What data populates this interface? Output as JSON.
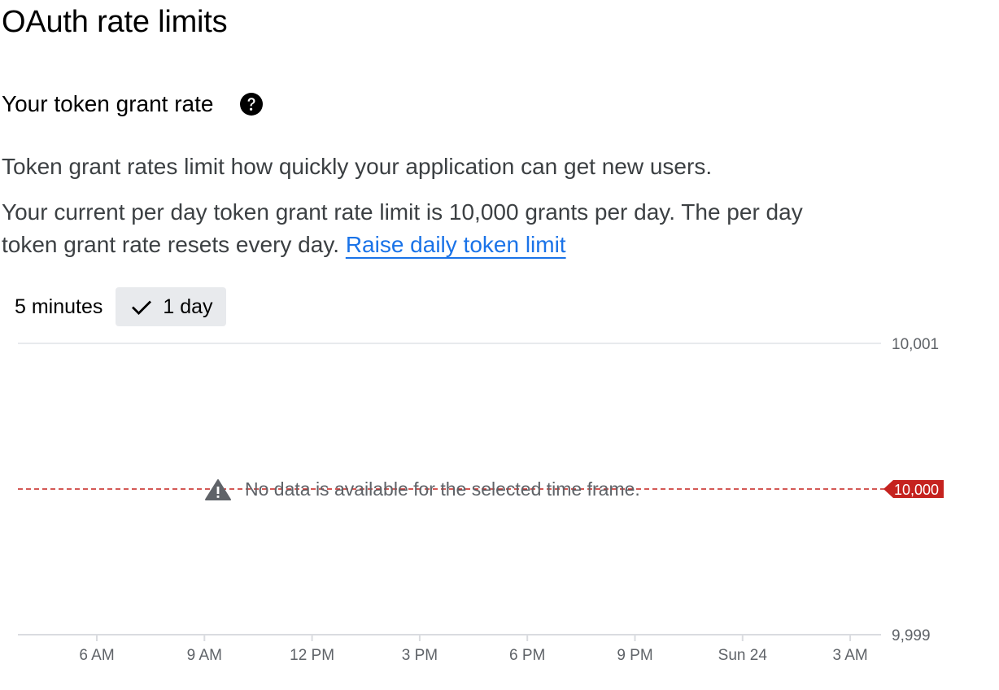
{
  "page": {
    "title": "OAuth rate limits"
  },
  "section": {
    "title": "Your token grant rate",
    "help_icon": "help-circle-icon",
    "description_1": "Token grant rates limit how quickly your application can get new users.",
    "description_2": "Your current per day token grant rate limit is 10,000 grants per day. The per day token grant rate resets every day.",
    "link_label": "Raise daily token limit"
  },
  "tabs": [
    {
      "label": "5 minutes",
      "selected": false
    },
    {
      "label": "1 day",
      "selected": true,
      "icon": "check-icon"
    }
  ],
  "colors": {
    "link": "#1a73e8",
    "limit": "#c5221f",
    "axis": "#dadce0",
    "muted_text": "#5f6368"
  },
  "chart_data": {
    "type": "line",
    "x_ticks": [
      "6 AM",
      "9 AM",
      "12 PM",
      "3 PM",
      "6 PM",
      "9 PM",
      "Sun 24",
      "3 AM"
    ],
    "y_ticks": [
      "10,001",
      "9,999"
    ],
    "ylim": [
      9999,
      10001
    ],
    "series": [],
    "limit": {
      "value": 10000,
      "label": "10,000"
    },
    "empty_message": "No data is available for the selected time frame.",
    "empty_icon": "warning-icon",
    "grid": true
  }
}
